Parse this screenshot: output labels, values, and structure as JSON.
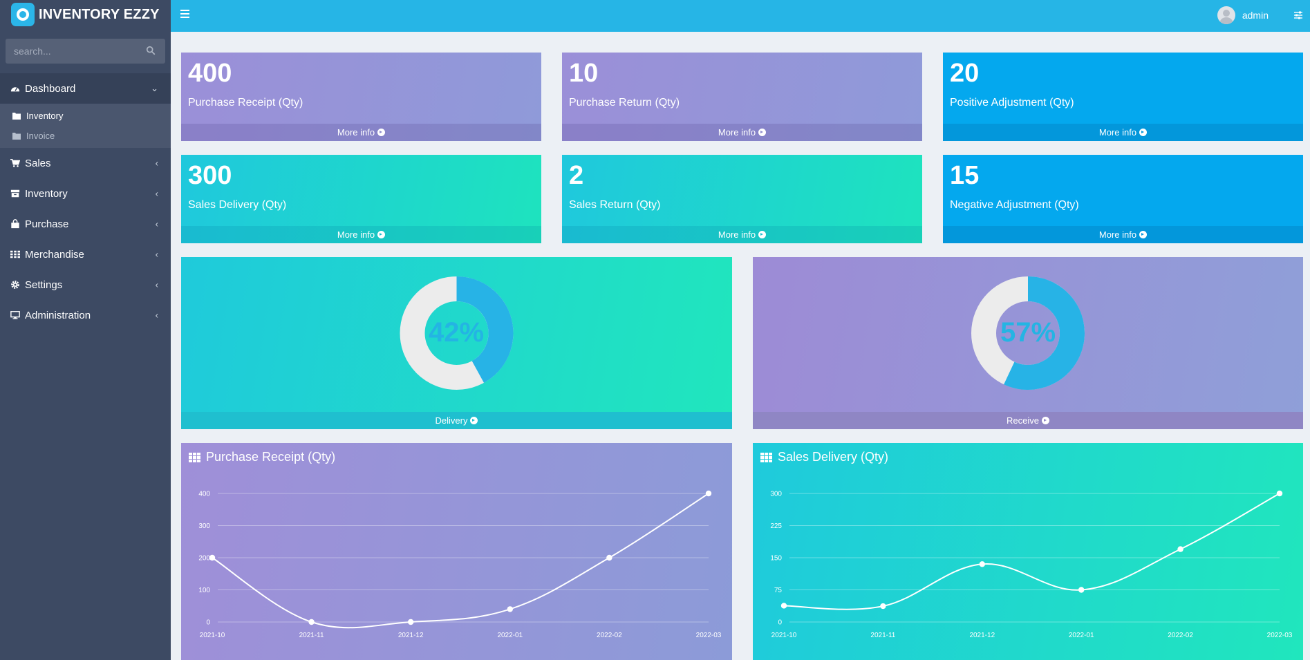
{
  "brand": {
    "name": "INVENTORY EZZY"
  },
  "search": {
    "placeholder": "search..."
  },
  "sidebar": {
    "items": [
      {
        "label": "Dashboard",
        "icon": "dashboard-icon"
      },
      {
        "label": "Sales",
        "icon": "cart-icon"
      },
      {
        "label": "Inventory",
        "icon": "archive-icon"
      },
      {
        "label": "Purchase",
        "icon": "shopping-bag-icon"
      },
      {
        "label": "Merchandise",
        "icon": "grid-icon"
      },
      {
        "label": "Settings",
        "icon": "gear-icon"
      },
      {
        "label": "Administration",
        "icon": "monitor-icon"
      }
    ],
    "dashboard_sub": [
      {
        "label": "Inventory",
        "icon": "folder-icon"
      },
      {
        "label": "Invoice",
        "icon": "folder-icon"
      }
    ]
  },
  "topbar": {
    "user_name": "admin"
  },
  "stats": [
    {
      "value": "400",
      "label": "Purchase Receipt (Qty)",
      "link": "More info"
    },
    {
      "value": "10",
      "label": "Purchase Return (Qty)",
      "link": "More info"
    },
    {
      "value": "20",
      "label": "Positive Adjustment (Qty)",
      "link": "More info"
    },
    {
      "value": "300",
      "label": "Sales Delivery (Qty)",
      "link": "More info"
    },
    {
      "value": "2",
      "label": "Sales Return (Qty)",
      "link": "More info"
    },
    {
      "value": "15",
      "label": "Negative Adjustment (Qty)",
      "link": "More info"
    }
  ],
  "donuts": [
    {
      "percent": 42,
      "text": "42%",
      "link": "Delivery"
    },
    {
      "percent": 57,
      "text": "57%",
      "link": "Receive"
    }
  ],
  "colors": {
    "accent": "#26b5e6",
    "donut_fill": "#27b3e6",
    "donut_track": "#ececec"
  },
  "chart_data": [
    {
      "type": "line",
      "title": "Purchase Receipt (Qty)",
      "x": [
        "2021-10",
        "2021-11",
        "2021-12",
        "2022-01",
        "2022-02",
        "2022-03"
      ],
      "y": [
        200,
        0,
        0,
        40,
        200,
        400
      ],
      "yticks": [
        0,
        100,
        200,
        300,
        400
      ],
      "ylim": [
        0,
        400
      ],
      "grid": true
    },
    {
      "type": "line",
      "title": "Sales Delivery (Qty)",
      "x": [
        "2021-10",
        "2021-11",
        "2021-12",
        "2022-01",
        "2022-02",
        "2022-03"
      ],
      "y": [
        38,
        37,
        135,
        75,
        170,
        300
      ],
      "yticks": [
        0,
        75,
        150,
        225,
        300
      ],
      "ylim": [
        0,
        300
      ],
      "grid": true
    }
  ]
}
